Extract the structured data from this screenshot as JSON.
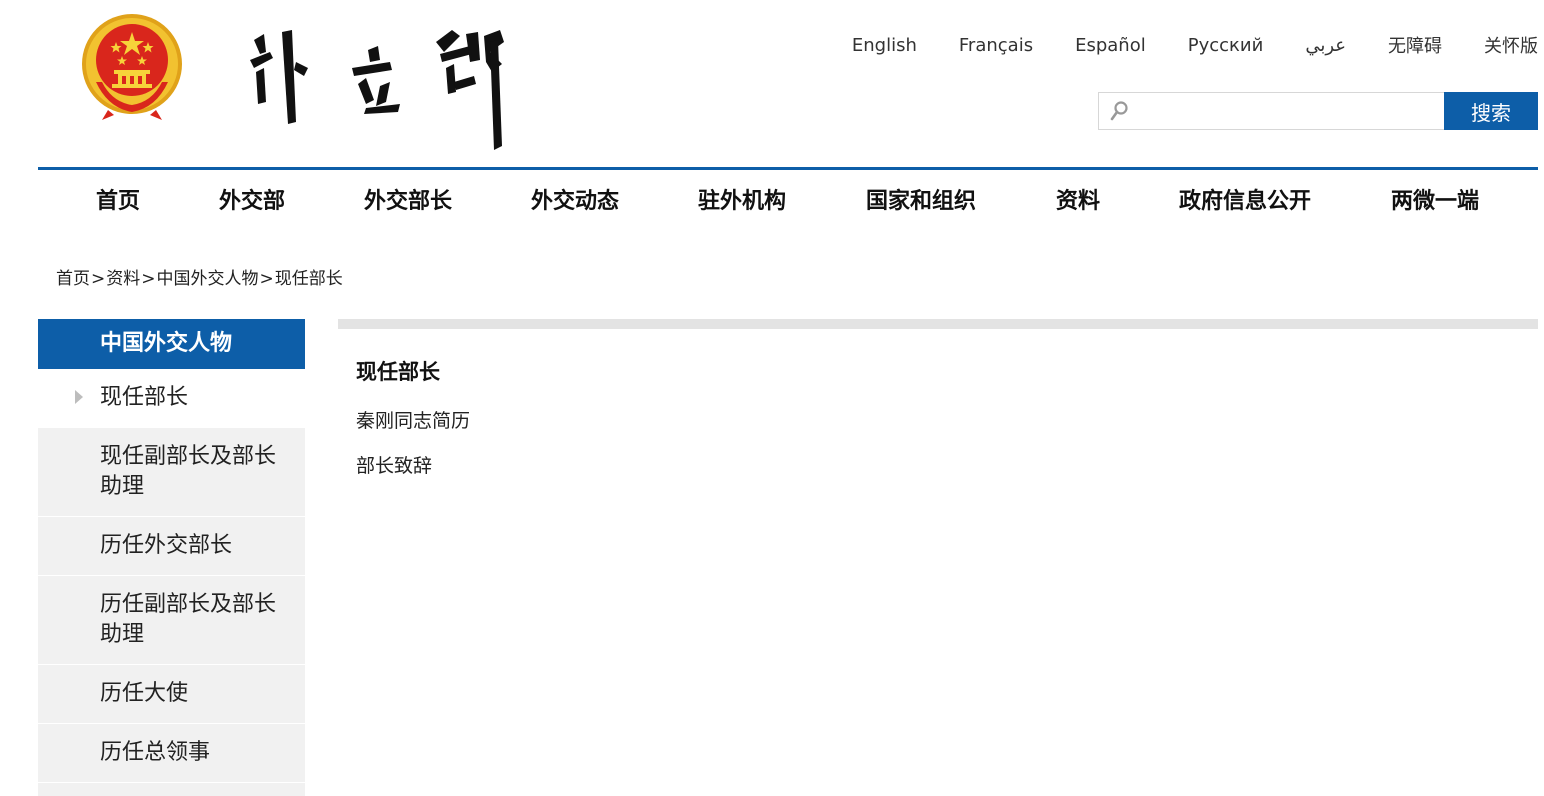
{
  "header": {
    "languages": [
      "English",
      "Français",
      "Español",
      "Русский",
      "عربي",
      "无障碍",
      "关怀版"
    ],
    "search": {
      "placeholder": "",
      "value": "",
      "button_label": "搜索"
    },
    "logo_icon": "national-emblem-icon",
    "calligraphy_icon": "ministry-calligraphy-logo"
  },
  "nav": {
    "items": [
      "首页",
      "外交部",
      "外交部长",
      "外交动态",
      "驻外机构",
      "国家和组织",
      "资料",
      "政府信息公开",
      "两微一端"
    ]
  },
  "breadcrumb": {
    "items": [
      "首页",
      "资料",
      "中国外交人物",
      "现任部长"
    ],
    "separator": ">"
  },
  "sidebar": {
    "title": "中国外交人物",
    "items": [
      "现任部长",
      "现任副部长及部长助理",
      "历任外交部长",
      "历任副部长及部长助理",
      "历任大使",
      "历任总领事"
    ],
    "active_index": 0
  },
  "content": {
    "title": "现任部长",
    "links": [
      "秦刚同志简历",
      "部长致辞"
    ]
  },
  "colors": {
    "brand_blue": "#0d5ea8",
    "sidebar_bg": "#f1f1f1",
    "content_bar": "#e3e3e3"
  }
}
